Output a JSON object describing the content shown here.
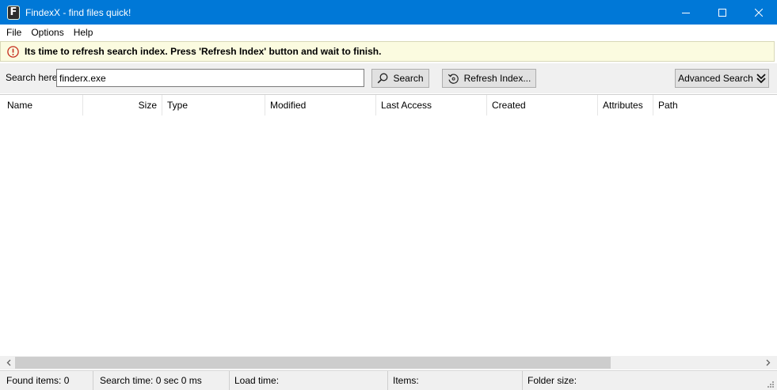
{
  "window": {
    "title": "FindexX - find files quick!",
    "app_icon_letter": "F",
    "accent_color": "#0078d7"
  },
  "menu": [
    "File",
    "Options",
    "Help"
  ],
  "notice": {
    "text": "Its time to refresh search index. Press 'Refresh Index' button and wait to finish.",
    "icon": "exclamation-circle-icon",
    "color": "#c42b1c"
  },
  "search": {
    "label": "Search here",
    "value": "finderx.exe",
    "search_button": "Search",
    "refresh_button": "Refresh Index...",
    "advanced_button": "Advanced Search"
  },
  "columns": [
    "Name",
    "Size",
    "Type",
    "Modified",
    "Last Access",
    "Created",
    "Attributes",
    "Path"
  ],
  "rows": [],
  "status": {
    "found": "Found items: 0",
    "search_time": "Search time: 0 sec 0 ms",
    "load_time": "Load time:",
    "items": "Items:",
    "folder_size": "Folder size:"
  }
}
